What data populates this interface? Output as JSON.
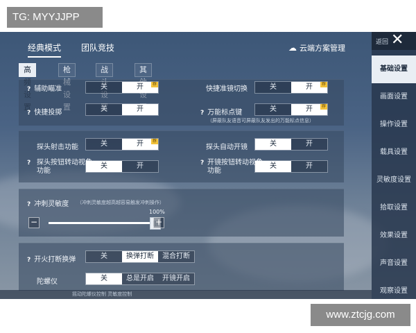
{
  "watermarks": {
    "top": "TG: MYYJJPP",
    "bottom": "www.ztcjg.com"
  },
  "header": {
    "tabs": [
      {
        "label": "经典模式"
      },
      {
        "label": "团队竞技"
      }
    ],
    "cloud_link": "云端方案管理"
  },
  "sub_tabs": [
    {
      "label": "高频设置"
    },
    {
      "label": "枪械设置"
    },
    {
      "label": "战斗设置"
    },
    {
      "label": "其他设置"
    }
  ],
  "right_panel": {
    "back_label": "返回",
    "items": [
      {
        "label": "基础设置"
      },
      {
        "label": "画面设置"
      },
      {
        "label": "操作设置"
      },
      {
        "label": "载具设置"
      },
      {
        "label": "灵敏度设置"
      },
      {
        "label": "拾取设置"
      },
      {
        "label": "效果设置"
      },
      {
        "label": "声音设置"
      },
      {
        "label": "观察设置"
      }
    ]
  },
  "common": {
    "off": "关",
    "on": "开",
    "rec_badge": "荐"
  },
  "card1": {
    "aim_assist": {
      "label": "辅助瞄准",
      "selected": "开"
    },
    "quick_scope_switch": {
      "label": "快捷准镜切换",
      "selected": "开"
    },
    "quick_throw": {
      "label": "快捷投掷",
      "selected": "开"
    },
    "universal_marker": {
      "label": "万能标点键",
      "selected": "开"
    },
    "marker_note": "（屏蔽队友语音可屏蔽队友发出的万能标点信息）"
  },
  "card2": {
    "peek_fire": {
      "label": "探头射击功能",
      "selected": "开"
    },
    "peek_auto_scope": {
      "label": "探头自动开镜",
      "selected": "关"
    },
    "peek_button_rotate": {
      "label": "探头按钮转动视角功能",
      "selected": "关"
    },
    "scope_button_rotate": {
      "label": "开镜按钮转动视角功能",
      "selected": "关"
    }
  },
  "card3": {
    "sprint_sensitivity": {
      "label": "冲刺灵敏度",
      "note": "（冲刺灵敏度越高越容易触发冲刺操作）",
      "value_label": "100%",
      "value": 100
    }
  },
  "card4": {
    "fire_interrupt_reload": {
      "label": "开火打断换弹",
      "options": [
        "关",
        "换弹打断",
        "混合打断"
      ],
      "selected": "换弹打断"
    },
    "gyroscope": {
      "label": "陀螺仪",
      "options": [
        "关",
        "总是开启",
        "开镜开启"
      ],
      "selected": "关"
    }
  },
  "bottom_strip": "摇动陀螺仪控制    灵敏度控制"
}
